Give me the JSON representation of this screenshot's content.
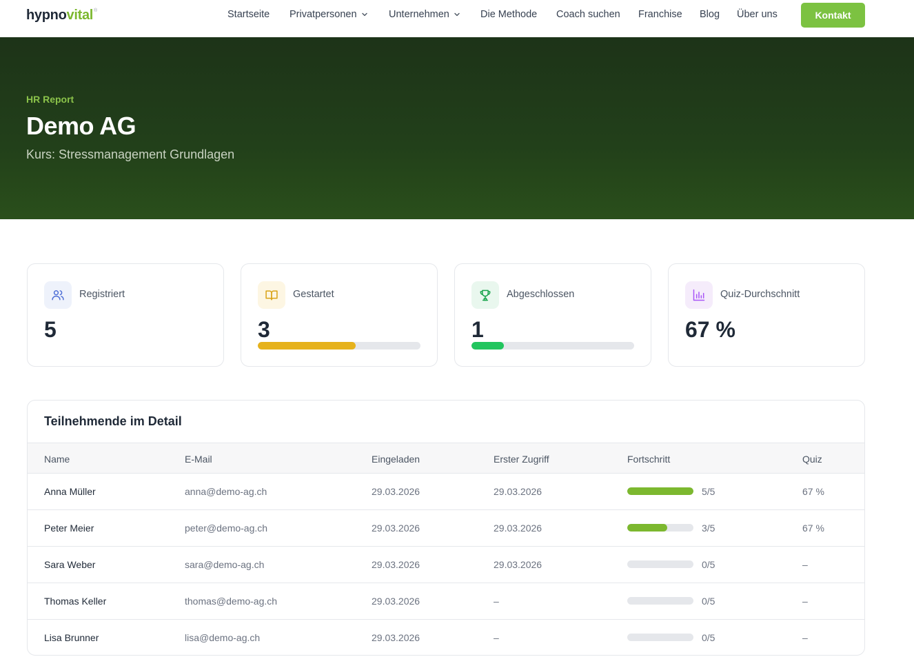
{
  "brand": {
    "name_part1": "hypno",
    "name_part2": "vital",
    "mark": "®",
    "accent": "#7cb82f"
  },
  "nav": {
    "items": [
      {
        "label": "Startseite",
        "dropdown": false
      },
      {
        "label": "Privatpersonen",
        "dropdown": true
      },
      {
        "label": "Unternehmen",
        "dropdown": true
      },
      {
        "label": "Die Methode",
        "dropdown": false
      },
      {
        "label": "Coach suchen",
        "dropdown": false
      },
      {
        "label": "Franchise",
        "dropdown": false
      },
      {
        "label": "Blog",
        "dropdown": false
      },
      {
        "label": "Über uns",
        "dropdown": false
      }
    ],
    "cta": "Kontakt"
  },
  "hero": {
    "eyebrow": "HR Report",
    "title": "Demo AG",
    "subtitle": "Kurs: Stressmanagement Grundlagen"
  },
  "stats": [
    {
      "label": "Registriert",
      "value": "5",
      "icon": "users-icon",
      "progress": null
    },
    {
      "label": "Gestartet",
      "value": "3",
      "icon": "book-open-icon",
      "progress": 0.6,
      "color": "#e6b21c"
    },
    {
      "label": "Abgeschlossen",
      "value": "1",
      "icon": "trophy-icon",
      "progress": 0.2,
      "color": "#22c55e"
    },
    {
      "label": "Quiz-Durchschnitt",
      "value": "67 %",
      "icon": "bar-chart-icon",
      "progress": null
    }
  ],
  "table": {
    "title": "Teilnehmende im Detail",
    "columns": [
      "Name",
      "E-Mail",
      "Eingeladen",
      "Erster Zugriff",
      "Fortschritt",
      "Quiz"
    ],
    "rows": [
      {
        "name": "Anna Müller",
        "email": "anna@demo-ag.ch",
        "invited": "29.03.2026",
        "first_access": "29.03.2026",
        "progress_fraction": 1.0,
        "progress": "5/5",
        "quiz": "67 %"
      },
      {
        "name": "Peter Meier",
        "email": "peter@demo-ag.ch",
        "invited": "29.03.2026",
        "first_access": "29.03.2026",
        "progress_fraction": 0.6,
        "progress": "3/5",
        "quiz": "67 %"
      },
      {
        "name": "Sara Weber",
        "email": "sara@demo-ag.ch",
        "invited": "29.03.2026",
        "first_access": "29.03.2026",
        "progress_fraction": 0,
        "progress": "0/5",
        "quiz": "–"
      },
      {
        "name": "Thomas Keller",
        "email": "thomas@demo-ag.ch",
        "invited": "29.03.2026",
        "first_access": "–",
        "progress_fraction": 0,
        "progress": "0/5",
        "quiz": "–"
      },
      {
        "name": "Lisa Brunner",
        "email": "lisa@demo-ag.ch",
        "invited": "29.03.2026",
        "first_access": "–",
        "progress_fraction": 0,
        "progress": "0/5",
        "quiz": "–"
      }
    ]
  }
}
